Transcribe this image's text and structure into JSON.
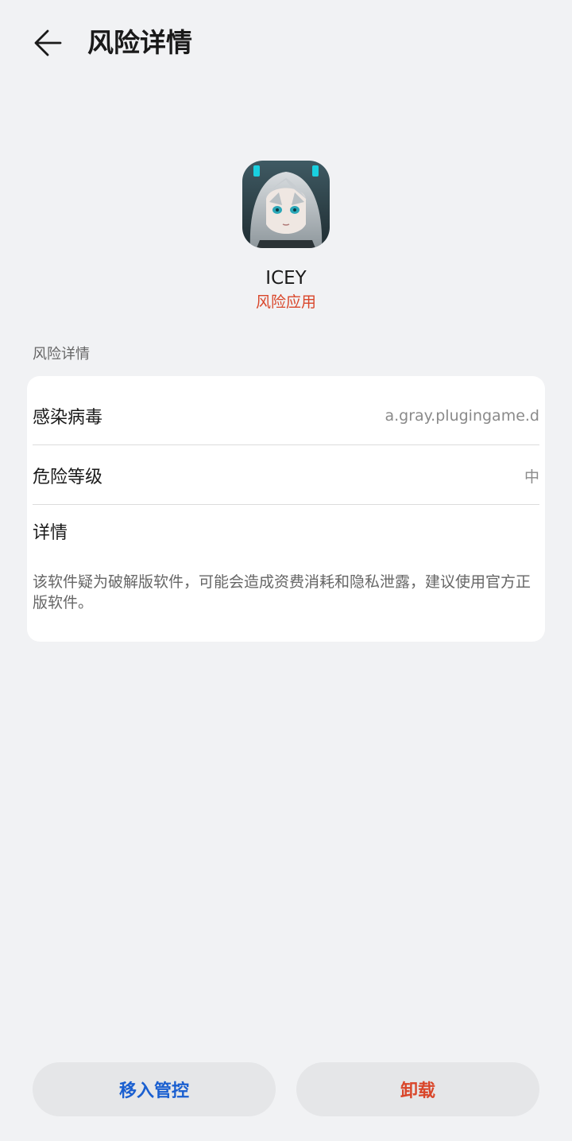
{
  "header": {
    "title": "风险详情",
    "back_icon": "arrow-left-icon"
  },
  "app": {
    "icon": "app-icon-anime-girl",
    "name": "ICEY",
    "status": "风险应用"
  },
  "section": {
    "label": "风险详情"
  },
  "rows": [
    {
      "label": "感染病毒",
      "value": "a.gray.plugingame.d"
    },
    {
      "label": "危险等级",
      "value": "中"
    }
  ],
  "details": {
    "title": "详情",
    "text": "该软件疑为破解版软件，可能会造成资费消耗和隐私泄露，建议使用官方正版软件。"
  },
  "actions": {
    "control_label": "移入管控",
    "uninstall_label": "卸载"
  },
  "colors": {
    "background": "#f1f2f4",
    "card": "#ffffff",
    "danger": "#d9462a",
    "primary": "#1a5fd0",
    "button_bg": "#e5e6e8"
  }
}
